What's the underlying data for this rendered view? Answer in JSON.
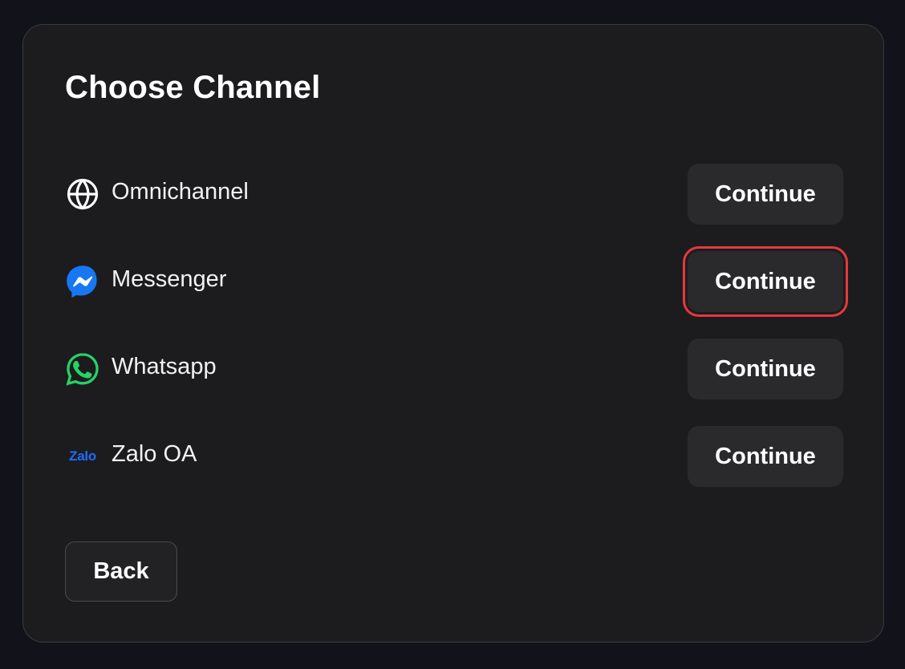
{
  "dialog": {
    "title": "Choose Channel",
    "channels": [
      {
        "label": "Omnichannel",
        "icon": "globe-icon",
        "button_label": "Continue"
      },
      {
        "label": "Messenger",
        "icon": "messenger-icon",
        "button_label": "Continue",
        "highlighted": true
      },
      {
        "label": "Whatsapp",
        "icon": "whatsapp-icon",
        "button_label": "Continue"
      },
      {
        "label": "Zalo OA",
        "icon": "zalo-icon",
        "icon_text": "Zalo",
        "button_label": "Continue"
      }
    ],
    "back_label": "Back"
  },
  "colors": {
    "background": "#12121a",
    "card": "#1c1c1e",
    "button": "#2a2a2d",
    "highlight": "#e5393d",
    "messenger": "#1877f2",
    "whatsapp": "#25d366",
    "zalo": "#1f6bff"
  }
}
